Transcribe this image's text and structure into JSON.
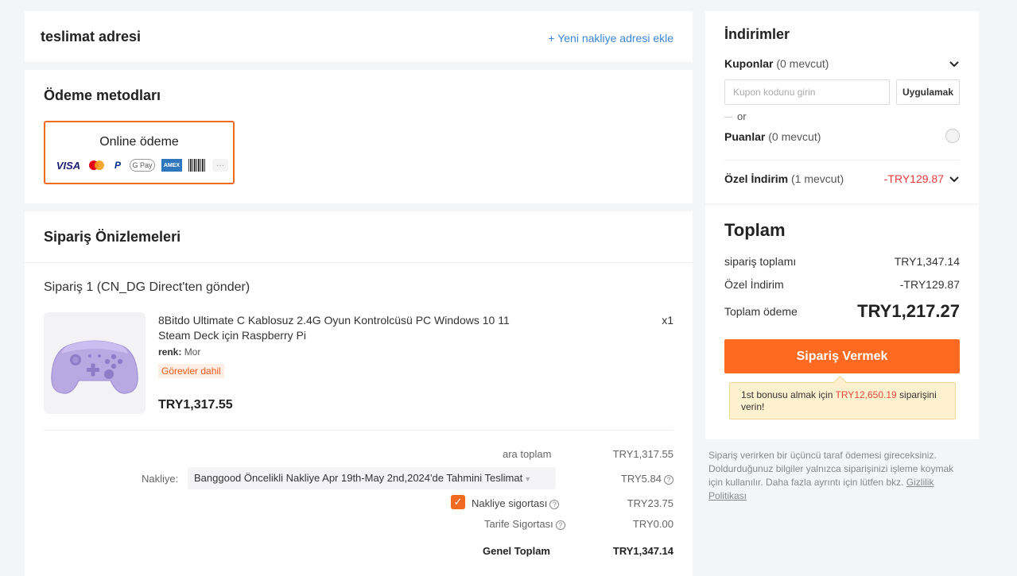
{
  "address": {
    "title": "teslimat adresi",
    "add_link": "+ Yeni nakliye adresi ekle"
  },
  "payment": {
    "title": "Ödeme metodları",
    "option_label": "Online ödeme",
    "logos": [
      "VISA",
      "mastercard",
      "PayPal",
      "G Pay",
      "AMEX",
      "boleto",
      "..."
    ]
  },
  "orders": {
    "title": "Sipariş Önizlemeleri",
    "order_heading": "Sipariş 1 (CN_DG Direct'ten gönder)",
    "product": {
      "name": "8Bitdo Ultimate C Kablosuz 2.4G Oyun Kontrolcüsü PC Windows 10 11 Steam Deck için Raspberry Pi",
      "color_label": "renk:",
      "color_value": "Mor",
      "tag": "Görevler dahil",
      "price": "TRY1,317.55",
      "qty": "x1"
    },
    "summary": {
      "subtotal_label": "ara toplam",
      "subtotal_value": "TRY1,317.55",
      "shipping_label": "Nakliye:",
      "shipping_option": "Banggood Öncelikli Nakliye Apr 19th-May 2nd,2024'de Tahmini Teslimat",
      "shipping_value": "TRY5.84",
      "insurance_label": "Nakliye sigortası",
      "insurance_value": "TRY23.75",
      "insurance_checked": true,
      "tariff_label": "Tarife Sigortası",
      "tariff_value": "TRY0.00",
      "grand_label": "Genel Toplam",
      "grand_value": "TRY1,347.14"
    }
  },
  "discounts": {
    "title": "İndirimler",
    "coupons_label": "Kuponlar",
    "coupons_count": "(0 mevcut)",
    "coupon_placeholder": "Kupon kodunu girin",
    "apply_label": "Uygulamak",
    "or_label": "or",
    "points_label": "Puanlar",
    "points_count": "(0 mevcut)",
    "special_label": "Özel İndirim",
    "special_count": "(1 mevcut)",
    "special_value": "-TRY129.87"
  },
  "total": {
    "title": "Toplam",
    "order_total_label": "sipariş toplamı",
    "order_total_value": "TRY1,347.14",
    "special_label": "Özel İndirim",
    "special_value": "-TRY129.87",
    "pay_label": "Toplam ödeme",
    "pay_value": "TRY1,217.27",
    "order_button": "Sipariş Vermek",
    "tip_prefix": "1st bonusu almak için",
    "tip_amount": "TRY12,650.19",
    "tip_suffix": "siparişini verin!"
  },
  "note": {
    "text": "Sipariş verirken bir üçüncü taraf ödemesi gireceksiniz. Doldurduğunuz bilgiler yalnızca siparişinizi işleme koymak için kullanılır. Daha fazla ayrıntı için lütfen bkz.",
    "link": "Gizlilik Politikası"
  },
  "colors": {
    "accent": "#ff6a22",
    "link": "#3a86d6",
    "discount_red": "#ea3a3a"
  }
}
